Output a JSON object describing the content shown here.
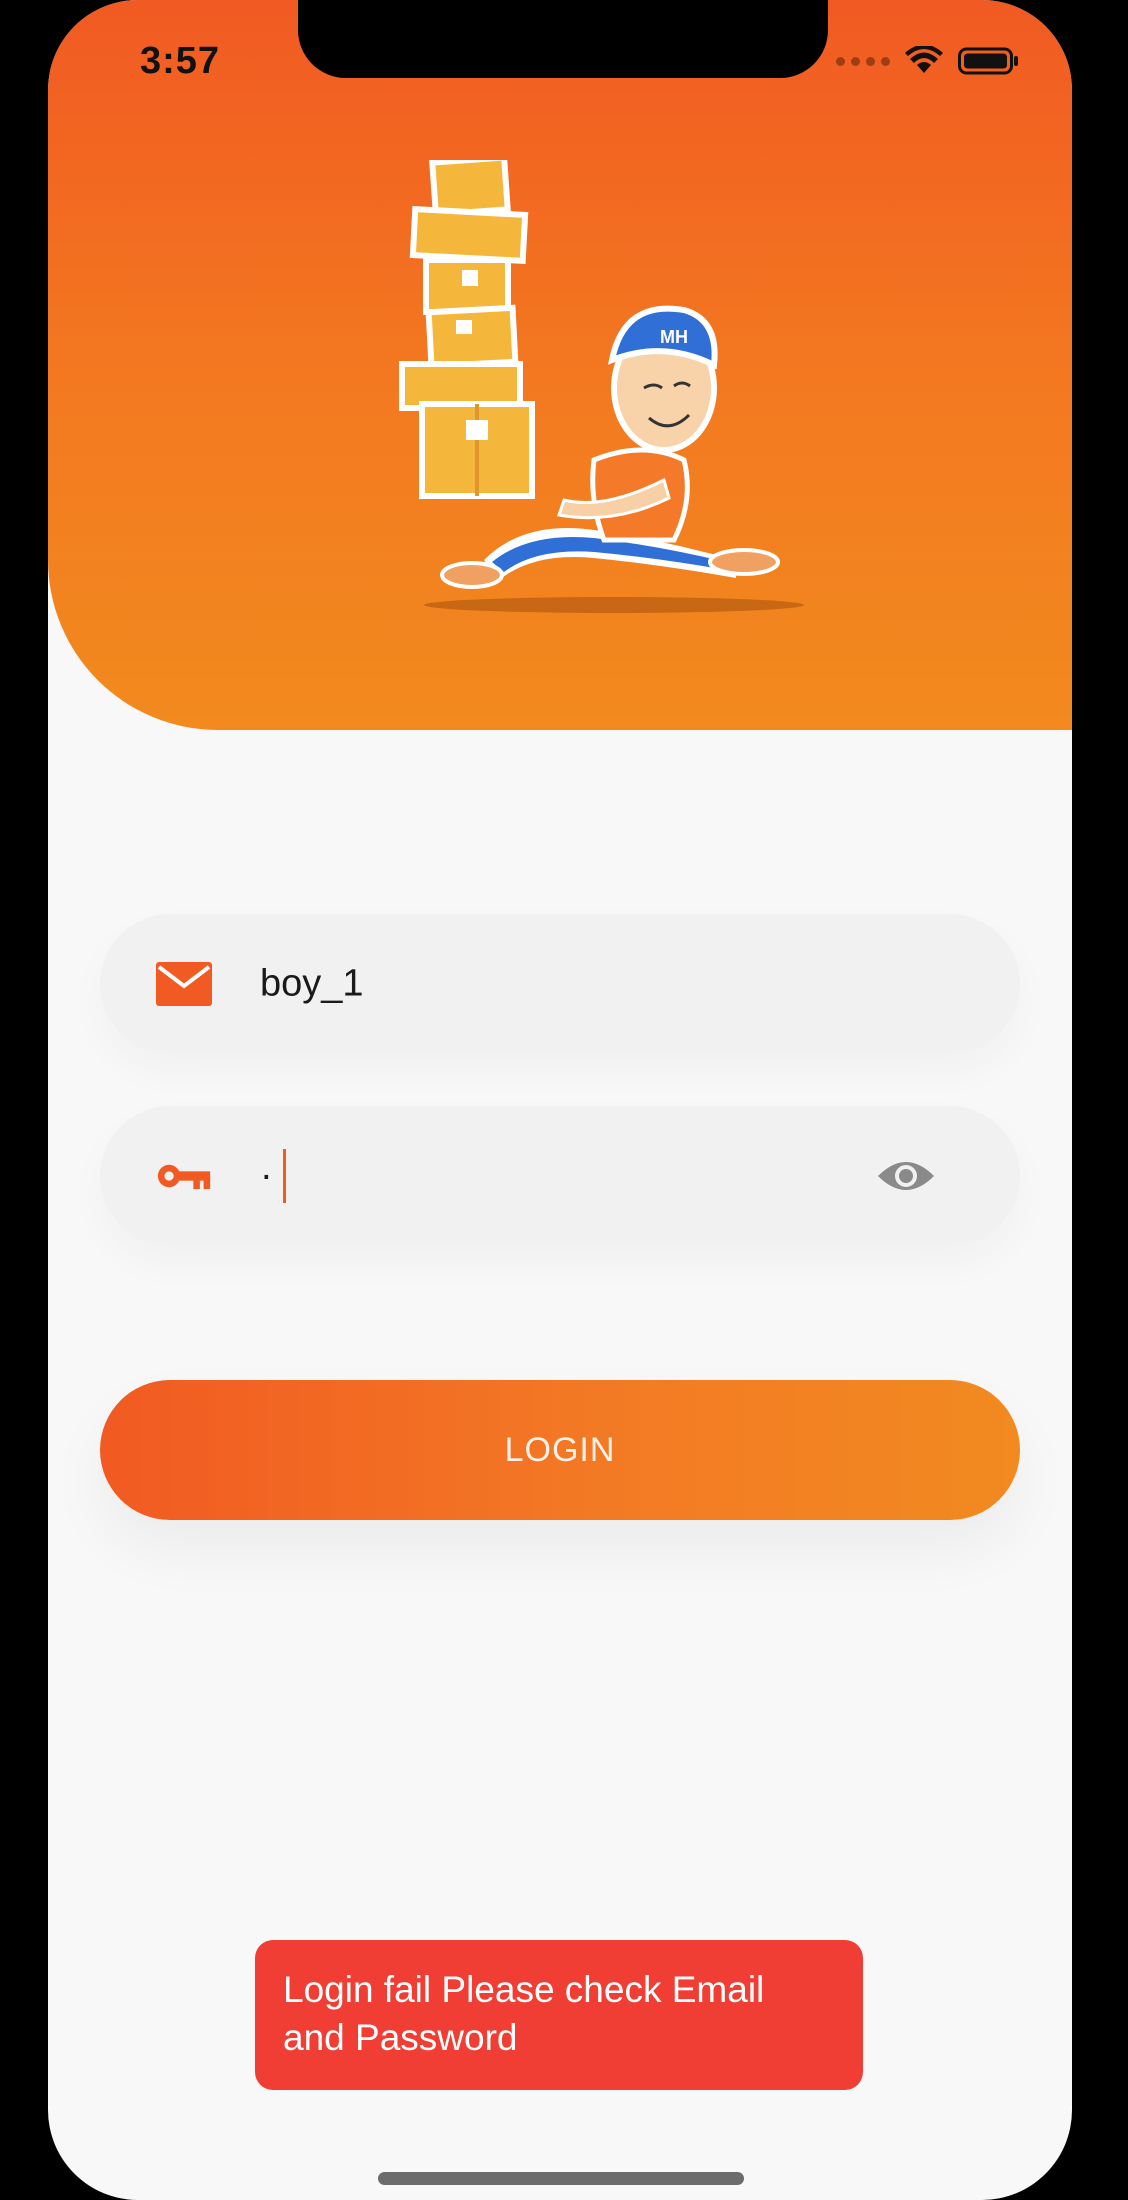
{
  "status_bar": {
    "time": "3:57"
  },
  "login_form": {
    "email_value": "boy_1",
    "password_value": "·",
    "login_label": "LOGIN"
  },
  "toast": {
    "message": "Login fail Please check Email and Password"
  },
  "colors": {
    "accent_orange": "#f15a22",
    "gradient_end": "#f28a1e",
    "error_red": "#f13e35"
  },
  "icons": {
    "email": "mail-icon",
    "password": "key-icon",
    "visibility": "eye-icon"
  },
  "illustration": {
    "cap_text": "MH"
  }
}
